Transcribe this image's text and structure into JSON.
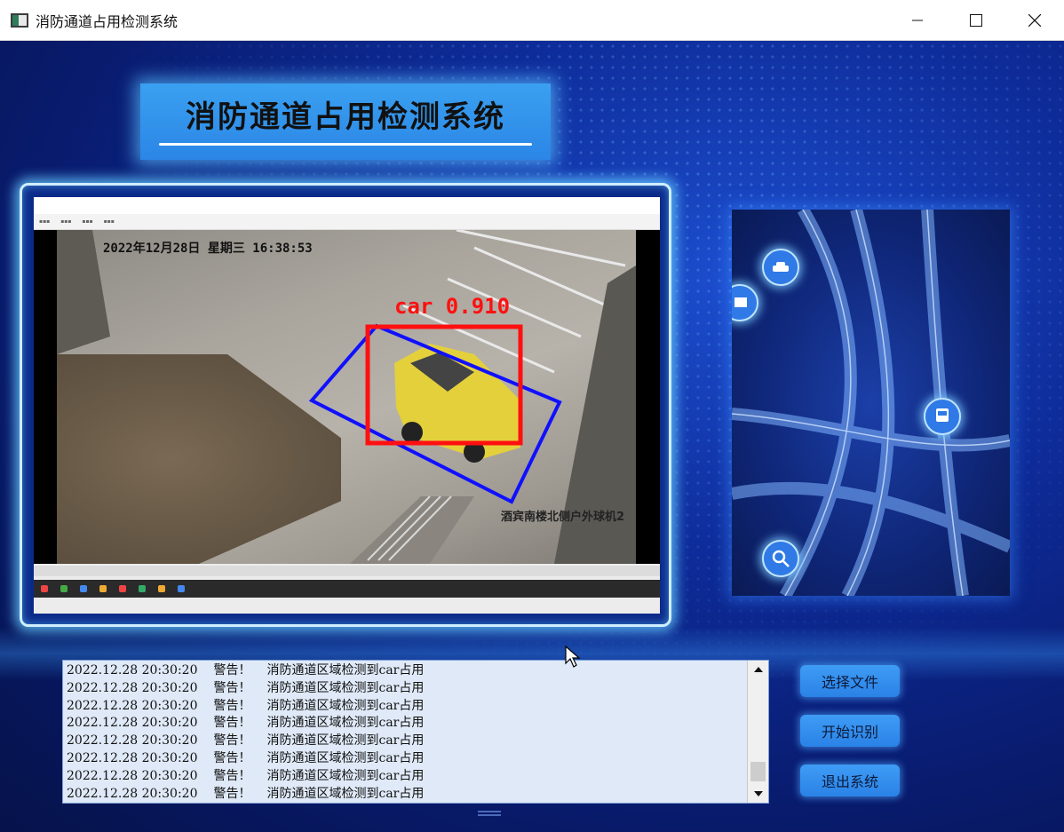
{
  "window": {
    "title": "消防通道占用检测系统",
    "controls": [
      "minimize-icon",
      "maximize-icon",
      "close-icon"
    ]
  },
  "header": {
    "title": "消防通道占用检测系统"
  },
  "video": {
    "timestamp": "2022年12月28日  星期三  16:38:53",
    "camera_name": "酒宾南楼北侧户外球机2",
    "detection_label": "car 0.910",
    "colors": {
      "box": "#ff1010",
      "zone": "#1010ff"
    }
  },
  "log": {
    "lines": [
      {
        "time": "2022.12.28 20:30:20",
        "level": "警告！",
        "msg": "消防通道区域检测到car占用"
      },
      {
        "time": "2022.12.28 20:30:20",
        "level": "警告！",
        "msg": "消防通道区域检测到car占用"
      },
      {
        "time": "2022.12.28 20:30:20",
        "level": "警告！",
        "msg": "消防通道区域检测到car占用"
      },
      {
        "time": "2022.12.28 20:30:20",
        "level": "警告！",
        "msg": "消防通道区域检测到car占用"
      },
      {
        "time": "2022.12.28 20:30:20",
        "level": "警告！",
        "msg": "消防通道区域检测到car占用"
      },
      {
        "time": "2022.12.28 20:30:20",
        "level": "警告！",
        "msg": "消防通道区域检测到car占用"
      },
      {
        "time": "2022.12.28 20:30:20",
        "level": "警告！",
        "msg": "消防通道区域检测到car占用"
      },
      {
        "time": "2022.12.28 20:30:20",
        "level": "警告！",
        "msg": "消防通道区域检测到car占用"
      }
    ]
  },
  "buttons": {
    "select_file": "选择文件",
    "start_detect": "开始识别",
    "exit": "退出系统"
  },
  "theme": {
    "accent": "#2b86e6",
    "background": "#0a1a5e"
  }
}
